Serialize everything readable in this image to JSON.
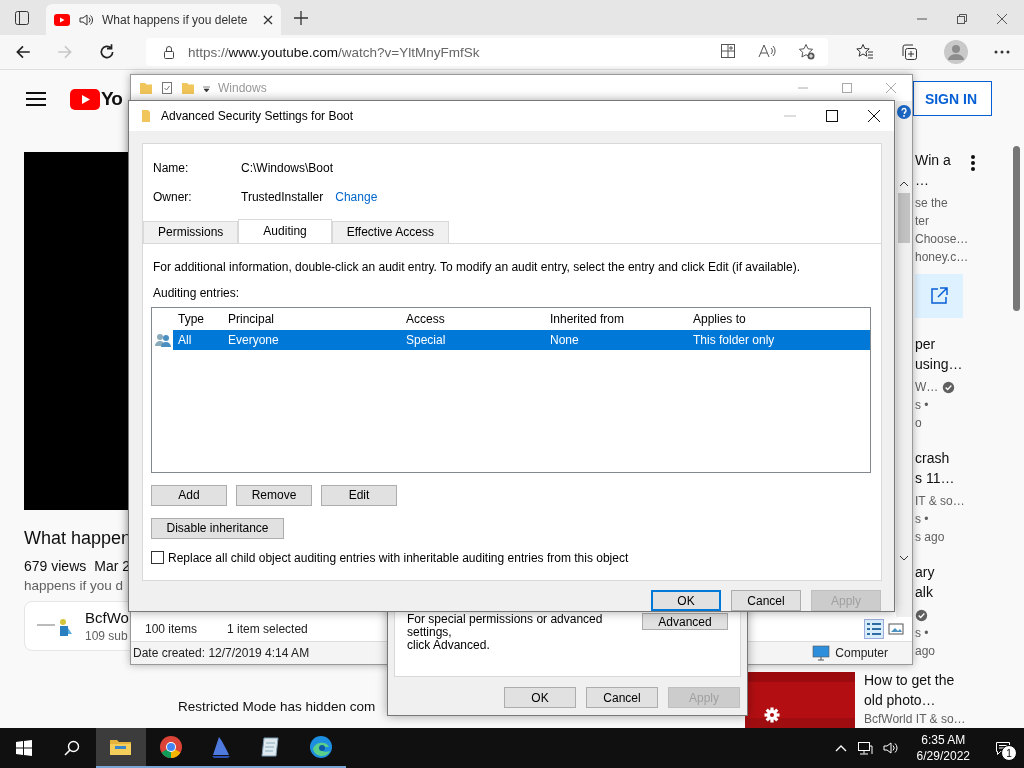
{
  "browser": {
    "tab": {
      "title": "What happens if you delete"
    },
    "nav": [
      {
        "kind": "back",
        "disabled": false
      },
      {
        "kind": "forward",
        "disabled": true
      },
      {
        "kind": "refresh",
        "disabled": false
      }
    ],
    "url": {
      "scheme": "https://",
      "host": "www.youtube.com",
      "path": "/watch?v=YltMnyFmfSk"
    }
  },
  "youtube": {
    "logo_text": "Yo",
    "sign_in": "SIGN IN",
    "video_title": "What happen",
    "views": "679 views",
    "date": "Mar 2",
    "description": "happens if you d",
    "channel": {
      "name": "BcfWo",
      "subscribers": "109 sub"
    },
    "restricted": "Restricted Mode has hidden com",
    "related": [
      {
        "title": [
          "Win a",
          "…"
        ],
        "meta": [
          {
            "text": "se the",
            "verified": false
          },
          {
            "text": "ter",
            "verified": false
          },
          {
            "text": "Choose…",
            "verified": false
          },
          {
            "text": "honey.c…",
            "verified": false
          }
        ],
        "more_menu": true,
        "ad_link": true
      },
      {
        "title": [
          "per",
          "using…"
        ],
        "meta": [
          {
            "text": "W…",
            "verified": true
          },
          {
            "text": "s •",
            "verified": false
          },
          {
            "text": "o",
            "verified": false
          }
        ],
        "more_menu": false,
        "ad_link": false
      },
      {
        "title": [
          "crash",
          "s 11…"
        ],
        "meta": [
          {
            "text": "IT & so…",
            "verified": false
          },
          {
            "text": "s •",
            "verified": false
          },
          {
            "text": "s ago",
            "verified": false
          }
        ],
        "more_menu": false,
        "ad_link": false
      },
      {
        "title": [
          "ary",
          "alk"
        ],
        "meta": [
          {
            "verified": true
          },
          {
            "text": "s •",
            "verified": false
          },
          {
            "text": "ago",
            "verified": false
          }
        ],
        "more_menu": false,
        "ad_link": false
      }
    ],
    "next_video": {
      "title": [
        "How to get the",
        "old photo…"
      ],
      "channel": "BcfWorld IT & so…"
    }
  },
  "explorer": {
    "title": "Windows",
    "item_count": "100 items",
    "selection": "1 item selected",
    "date_created": "Date created: 12/7/2019 4:14 AM",
    "location": "Computer",
    "views": [
      {
        "kind": "details",
        "selected": true
      },
      {
        "kind": "tiles",
        "selected": false
      }
    ]
  },
  "properties_dialog": {
    "text": [
      "For special permissions or advanced settings,",
      "click Advanced."
    ],
    "advanced_button": "Advanced",
    "buttons": [
      {
        "label": "OK",
        "disabled": false
      },
      {
        "label": "Cancel",
        "disabled": false
      },
      {
        "label": "Apply",
        "disabled": true
      }
    ]
  },
  "security_dialog": {
    "title": "Advanced Security Settings for Boot",
    "name_label": "Name:",
    "name": "C:\\Windows\\Boot",
    "owner_label": "Owner:",
    "owner": "TrustedInstaller",
    "change_link": "Change",
    "tabs": [
      {
        "label": "Permissions",
        "selected": false
      },
      {
        "label": "Auditing",
        "selected": true
      },
      {
        "label": "Effective Access",
        "selected": false
      }
    ],
    "info": "For additional information, double-click an audit entry. To modify an audit entry, select the entry and click Edit (if available).",
    "entries_label": "Auditing entries:",
    "columns": [
      "Type",
      "Principal",
      "Access",
      "Inherited from",
      "Applies to"
    ],
    "rows": [
      {
        "cells": [
          "All",
          "Everyone",
          "Special",
          "None",
          "This folder only"
        ],
        "selected": true
      }
    ],
    "actions": [
      "Add",
      "Remove",
      "Edit"
    ],
    "disable_inheritance": "Disable inheritance",
    "replace_child": {
      "label": "Replace all child object auditing entries with inheritable auditing entries from this object",
      "checked": false
    },
    "buttons": [
      {
        "label": "OK",
        "default": true,
        "disabled": false
      },
      {
        "label": "Cancel",
        "default": false,
        "disabled": false
      },
      {
        "label": "Apply",
        "default": false,
        "disabled": true
      }
    ]
  },
  "taskbar": {
    "apps": [
      {
        "kind": "explorer",
        "selected": true,
        "running": true
      },
      {
        "kind": "chrome",
        "selected": false,
        "running": true
      },
      {
        "kind": "sail",
        "selected": false,
        "running": true
      },
      {
        "kind": "notepad",
        "selected": false,
        "running": true
      },
      {
        "kind": "edge",
        "selected": false,
        "running": true
      }
    ],
    "time": "6:35 AM",
    "date": "6/29/2022",
    "notifications": "1"
  }
}
